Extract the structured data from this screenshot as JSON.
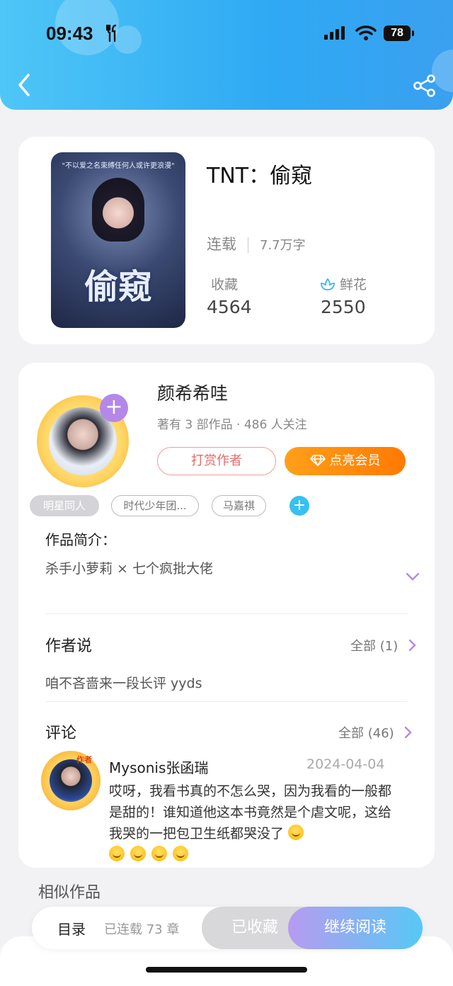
{
  "status_bar": {
    "time": "09:43",
    "battery": "78"
  },
  "book": {
    "title": "TNT：偷窥",
    "status": "连载",
    "word_count": "7.7万字",
    "favorites_label": "收藏",
    "favorites_value": "4564",
    "flowers_label": "鲜花",
    "flowers_value": "2550",
    "cover_title": "偷窥",
    "cover_tagline": "\"不以爱之名束缚任何人或许更浪漫\""
  },
  "author": {
    "name": "颜希希哇",
    "stats": "著有 3 部作品 · 486 人关注",
    "reward_label": "打赏作者",
    "vip_label": "点亮会员",
    "follow_label": "+"
  },
  "tags": [
    "明星同人",
    "时代少年团...",
    "马嘉祺"
  ],
  "intro": {
    "title": "作品简介：",
    "text": "杀手小萝莉 × 七个疯批大佬"
  },
  "author_says": {
    "title": "作者说",
    "more": "全部 (1)",
    "text": "咱不吝啬来一段长评 yyds"
  },
  "comments": {
    "title": "评论",
    "more": "全部 (46)",
    "items": [
      {
        "user": "Mysonis张函瑞",
        "badge": "作者",
        "date": "2024-04-04",
        "text": "哎呀，我看书真的不怎么哭，因为我看的一般都是甜的！谁知道他这本书竟然是个虐文呢，这给我哭的一把包卫生纸都哭没了"
      }
    ]
  },
  "similar_title": "相似作品",
  "bottom_bar": {
    "toc": "目录",
    "chapters": "已连载 73 章",
    "collected": "已收藏",
    "continue": "继续阅读"
  },
  "colors": {
    "header_blue": "#2fa9f3",
    "vip_orange": "#ff8a00",
    "reward_red": "#e56b6b",
    "accent_purple": "#b488e8"
  }
}
